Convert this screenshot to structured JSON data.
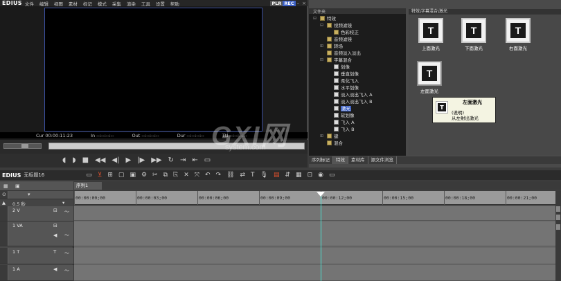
{
  "player": {
    "app_name": "EDIUS",
    "menu": [
      "文件",
      "编辑",
      "视图",
      "素材",
      "标记",
      "模式",
      "采集",
      "渲染",
      "工具",
      "设置",
      "帮助"
    ],
    "mode_plr": "PLR",
    "mode_rec": "REC",
    "timecodes": {
      "cur": "Cur 00:00:11:23",
      "in": "In --:--:--:--",
      "out": "Out --:--:--:--",
      "dur": "Dur --:--:--:--",
      "ttl": "Ttl --:--:--:--"
    }
  },
  "effects": {
    "tree_header": "文件夹",
    "tree": [
      {
        "label": "特效",
        "level": 0,
        "folder": true,
        "expander": "-"
      },
      {
        "label": "视频滤镜",
        "level": 1,
        "folder": true,
        "expander": "-"
      },
      {
        "label": "色彩校正",
        "level": 2,
        "folder": true,
        "expander": ""
      },
      {
        "label": "音频滤镜",
        "level": 1,
        "folder": true,
        "expander": ""
      },
      {
        "label": "转场",
        "level": 1,
        "folder": true,
        "expander": "+"
      },
      {
        "label": "音频淡入淡出",
        "level": 1,
        "folder": true,
        "expander": ""
      },
      {
        "label": "字幕混合",
        "level": 1,
        "folder": true,
        "expander": "-"
      },
      {
        "label": "划像",
        "level": 2,
        "folder": false,
        "expander": ""
      },
      {
        "label": "垂直划像",
        "level": 2,
        "folder": false,
        "expander": ""
      },
      {
        "label": "柔化飞入",
        "level": 2,
        "folder": false,
        "expander": ""
      },
      {
        "label": "水平划像",
        "level": 2,
        "folder": false,
        "expander": ""
      },
      {
        "label": "淡入淡出飞入 A",
        "level": 2,
        "folder": false,
        "expander": ""
      },
      {
        "label": "淡入淡出飞入 B",
        "level": 2,
        "folder": false,
        "expander": ""
      },
      {
        "label": "激光",
        "level": 2,
        "folder": false,
        "expander": "",
        "selected": true
      },
      {
        "label": "软划像",
        "level": 2,
        "folder": false,
        "expander": ""
      },
      {
        "label": "飞入 A",
        "level": 2,
        "folder": false,
        "expander": ""
      },
      {
        "label": "飞入 B",
        "level": 2,
        "folder": false,
        "expander": ""
      },
      {
        "label": "键",
        "level": 1,
        "folder": true,
        "expander": "+"
      },
      {
        "label": "混合",
        "level": 1,
        "folder": true,
        "expander": ""
      }
    ],
    "breadcrumb": "特效\\字幕混合\\激光",
    "items": [
      {
        "label": "上面激光",
        "letter": "T"
      },
      {
        "label": "下面激光",
        "letter": "T"
      },
      {
        "label": "右面激光",
        "letter": "T"
      },
      {
        "label": "左面激光",
        "letter": "T"
      }
    ],
    "tooltip": {
      "title": "左面激光",
      "desc_label": "(说明)",
      "desc": "从左射出激光"
    },
    "tabs": [
      "序列标记",
      "特效",
      "素材库",
      "源文件浏览"
    ]
  },
  "timeline": {
    "app_name": "EDIUS",
    "project": "无标题16",
    "sequence_tab": "序列1",
    "zoom": "0.5 秒",
    "ruler": [
      "00:00:00;00",
      "00:00:03;00",
      "00:00:06;00",
      "00:00:09;00",
      "00:00:12;00",
      "00:00:15;00",
      "00:00:18;00",
      "00:00:21;00"
    ],
    "tracks": [
      {
        "label": "2 V"
      },
      {
        "label": "1 VA"
      },
      {
        "label": "1 T"
      },
      {
        "label": "1 A"
      }
    ]
  },
  "watermark": {
    "main": "GXI网",
    "sub": "system.com"
  }
}
